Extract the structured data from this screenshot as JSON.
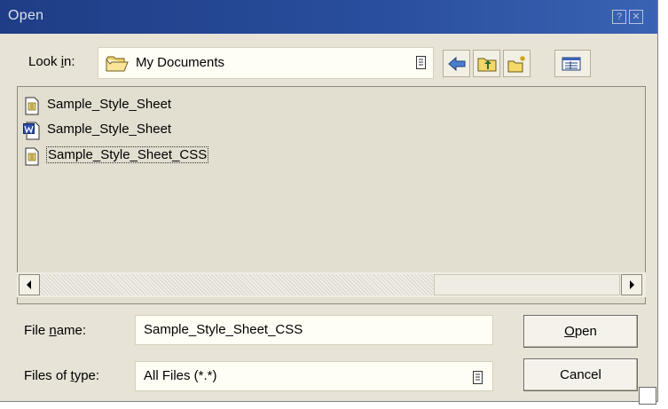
{
  "window": {
    "title": "Open",
    "help_glyph": "?",
    "close_glyph": "✕"
  },
  "look_in": {
    "label_pre": "Look ",
    "label_ul": "i",
    "label_post": "n:",
    "value": "My Documents",
    "icon": "folder-icon"
  },
  "toolbar": {
    "buttons": [
      "back-icon",
      "up-one-level-icon",
      "new-folder-icon",
      "view-menu-icon"
    ]
  },
  "files": [
    {
      "name": "Sample_Style_Sheet",
      "icon": "stylesheet-file-icon",
      "selected": false
    },
    {
      "name": "Sample_Style_Sheet",
      "icon": "word-document-icon",
      "selected": false
    },
    {
      "name": "Sample_Style_Sheet_CSS",
      "icon": "stylesheet-file-icon",
      "selected": true
    }
  ],
  "file_name": {
    "label_pre": "File ",
    "label_ul": "n",
    "label_post": "ame:",
    "value": "Sample_Style_Sheet_CSS"
  },
  "file_type": {
    "label_pre": "Files of ",
    "label_ul": "t",
    "label_post": "ype:",
    "value": "All Files (*.*)"
  },
  "buttons": {
    "open_ul": "O",
    "open_rest": "pen",
    "cancel": "Cancel"
  },
  "colors": {
    "titlebar": "#1e3d85",
    "dialog_bg": "#e7e3d6",
    "list_bg": "#e2ded0"
  }
}
